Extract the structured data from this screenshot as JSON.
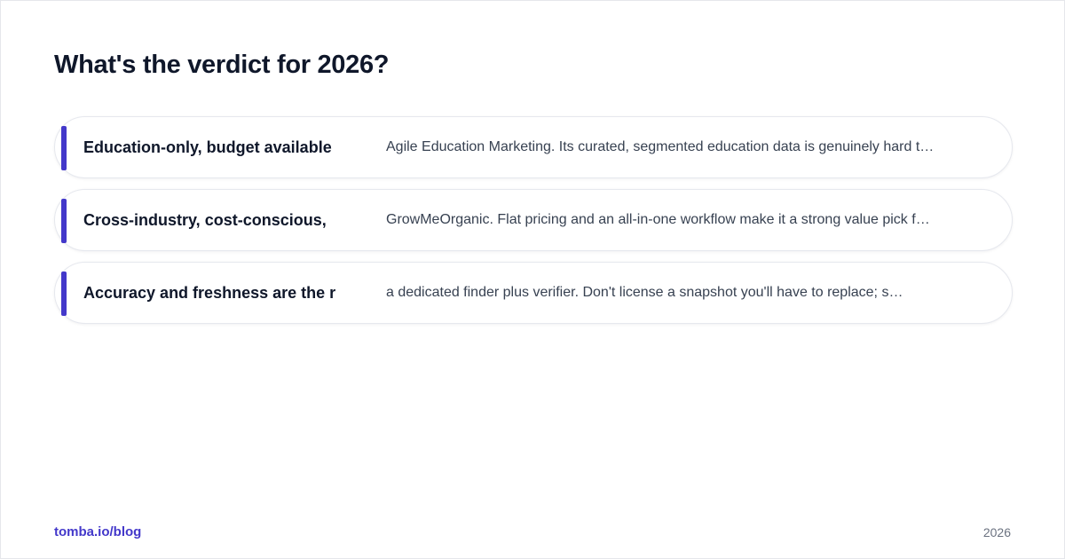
{
  "title": "What's the verdict for 2026?",
  "accent_color": "#4338ca",
  "rows": [
    {
      "label": "Education-only, budget available",
      "description": "Agile Education Marketing. Its curated, segmented education data is genuinely hard t…"
    },
    {
      "label": "Cross-industry, cost-conscious,",
      "description": "GrowMeOrganic. Flat pricing and an all-in-one workflow make it a strong value pick f…"
    },
    {
      "label": "Accuracy and freshness are the r",
      "description": "a dedicated finder plus verifier. Don't license a snapshot you'll have to replace; s…"
    }
  ],
  "footer": {
    "link": "tomba.io/blog",
    "year": "2026"
  }
}
